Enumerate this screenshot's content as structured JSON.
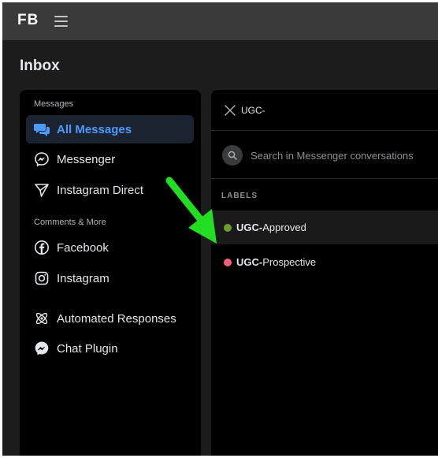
{
  "app": {
    "logo": "FB"
  },
  "page": {
    "title": "Inbox"
  },
  "sidebar": {
    "sections": [
      {
        "label": "Messages"
      },
      {
        "label": "Comments & More"
      }
    ],
    "items": [
      {
        "label": "All Messages",
        "icon": "chat-bubbles-icon",
        "active": true
      },
      {
        "label": "Messenger",
        "icon": "messenger-icon"
      },
      {
        "label": "Instagram Direct",
        "icon": "paper-plane-icon"
      },
      {
        "label": "Facebook",
        "icon": "facebook-icon"
      },
      {
        "label": "Instagram",
        "icon": "instagram-icon"
      },
      {
        "label": "Automated Responses",
        "icon": "atom-icon"
      },
      {
        "label": "Chat Plugin",
        "icon": "messenger-icon"
      }
    ]
  },
  "panel": {
    "label_search": {
      "value": "UGC-"
    },
    "message_search": {
      "placeholder": "Search in Messenger conversations"
    },
    "labels_heading": "LABELS",
    "labels": [
      {
        "match": "UGC-",
        "rest": "Approved",
        "color": "#6b9e2f"
      },
      {
        "match": "UGC-",
        "rest": "Prospective",
        "color": "#f0627a"
      }
    ]
  },
  "colors": {
    "accent": "#4b9bff",
    "arrow": "#22dd22"
  }
}
